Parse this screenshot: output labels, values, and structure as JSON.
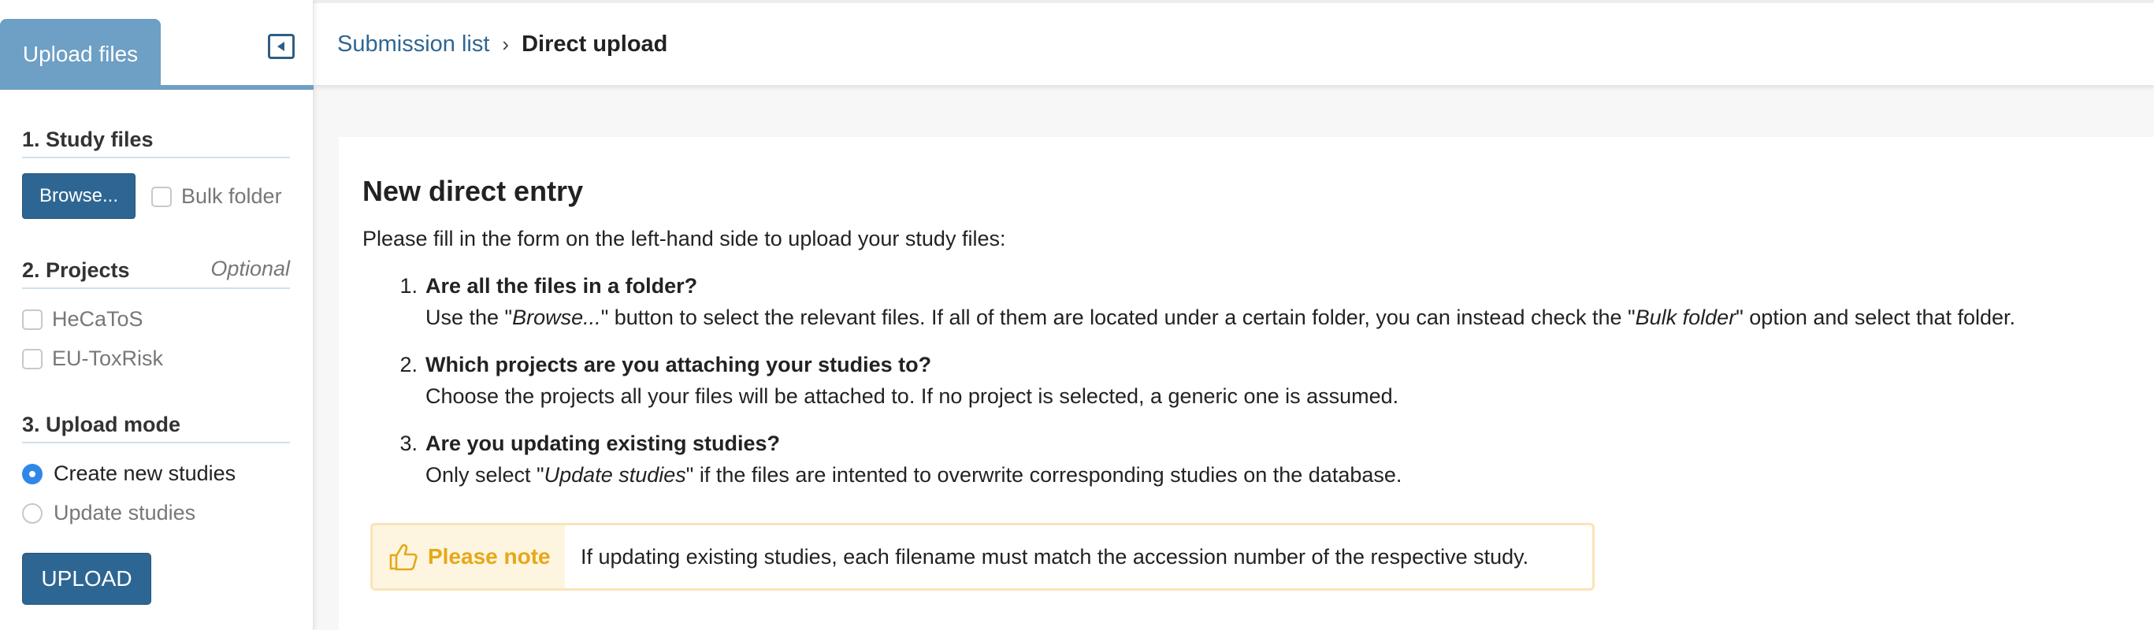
{
  "sidebar": {
    "tab_label": "Upload files",
    "collapse_icon": "collapse-left-icon",
    "sections": {
      "study_files": {
        "title": "1. Study files",
        "browse_label": "Browse...",
        "bulk_label": "Bulk folder"
      },
      "projects": {
        "title": "2. Projects",
        "optional_label": "Optional",
        "items": [
          "HeCaToS",
          "EU-ToxRisk"
        ]
      },
      "upload_mode": {
        "title": "3. Upload mode",
        "options": [
          "Create new studies",
          "Update studies"
        ],
        "selected": "Create new studies"
      }
    },
    "upload_label": "UPLOAD"
  },
  "breadcrumb": {
    "parent": "Submission list",
    "separator": "›",
    "current": "Direct upload"
  },
  "main": {
    "title": "New direct entry",
    "intro": "Please fill in the form on the left-hand side to upload your study files:",
    "steps": [
      {
        "num": "1.",
        "question": "Are all the files in a folder?",
        "desc_parts": [
          "Use the \"",
          "Browse...",
          "\" button to select the relevant files. If all of them are located under a certain folder, you can instead check the \"",
          "Bulk folder",
          "\" option and select that folder."
        ]
      },
      {
        "num": "2.",
        "question": "Which projects are you attaching your studies to?",
        "desc": "Choose the projects all your files will be attached to. If no project is selected, a generic one is assumed."
      },
      {
        "num": "3.",
        "question": "Are you updating existing studies?",
        "desc_parts": [
          "Only select \"",
          "Update studies",
          "\" if the files are intented to overwrite corresponding studies on the database."
        ]
      }
    ],
    "note": {
      "icon": "thumbs-up-pointing-icon",
      "label": "Please note",
      "text": "If updating existing studies, each filename must match the accession number of the respective study."
    }
  },
  "colors": {
    "accent": "#2e6693",
    "tab": "#6e9fc4",
    "radio_selected": "#2f88e8",
    "note_label": "#e6a817"
  }
}
